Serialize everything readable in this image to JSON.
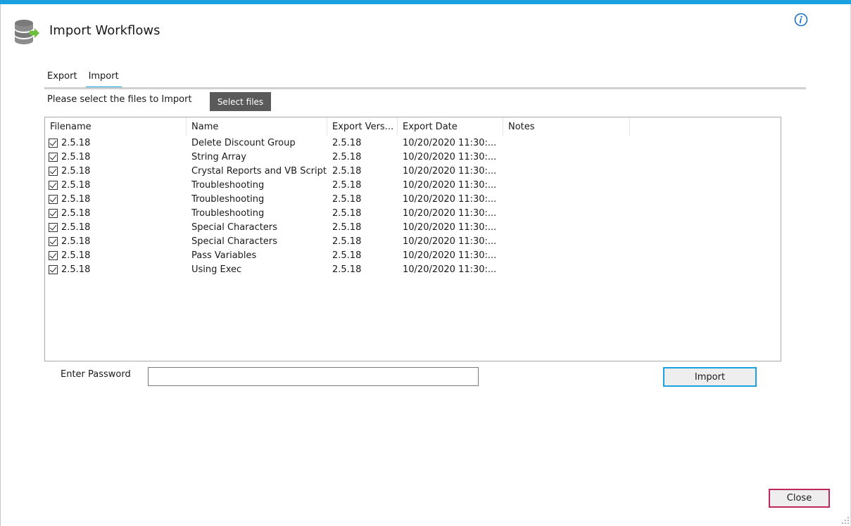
{
  "window": {
    "title": "Import Workflows"
  },
  "tabs": [
    {
      "label": "Export",
      "active": false
    },
    {
      "label": "Import",
      "active": true
    }
  ],
  "import": {
    "prompt": "Please select the files to Import",
    "select_button": "Select files"
  },
  "grid": {
    "columns": [
      "Filename",
      "Name",
      "Export Vers...",
      "Export Date",
      "Notes"
    ],
    "rows": [
      {
        "checked": true,
        "filename": "2.5.18",
        "name": "Delete Discount Group",
        "version": "2.5.18",
        "date": "10/20/2020 11:30:...",
        "notes": ""
      },
      {
        "checked": true,
        "filename": "2.5.18",
        "name": "String Array",
        "version": "2.5.18",
        "date": "10/20/2020 11:30:...",
        "notes": ""
      },
      {
        "checked": true,
        "filename": "2.5.18",
        "name": "Crystal Reports and VB Script",
        "version": "2.5.18",
        "date": "10/20/2020 11:30:...",
        "notes": ""
      },
      {
        "checked": true,
        "filename": "2.5.18",
        "name": "Troubleshooting",
        "version": "2.5.18",
        "date": "10/20/2020 11:30:...",
        "notes": ""
      },
      {
        "checked": true,
        "filename": "2.5.18",
        "name": "Troubleshooting",
        "version": "2.5.18",
        "date": "10/20/2020 11:30:...",
        "notes": ""
      },
      {
        "checked": true,
        "filename": "2.5.18",
        "name": "Troubleshooting",
        "version": "2.5.18",
        "date": "10/20/2020 11:30:...",
        "notes": ""
      },
      {
        "checked": true,
        "filename": "2.5.18",
        "name": "Special Characters",
        "version": "2.5.18",
        "date": "10/20/2020 11:30:...",
        "notes": ""
      },
      {
        "checked": true,
        "filename": "2.5.18",
        "name": "Special Characters",
        "version": "2.5.18",
        "date": "10/20/2020 11:30:...",
        "notes": ""
      },
      {
        "checked": true,
        "filename": "2.5.18",
        "name": "Pass Variables",
        "version": "2.5.18",
        "date": "10/20/2020 11:30:...",
        "notes": ""
      },
      {
        "checked": true,
        "filename": "2.5.18",
        "name": "Using Exec",
        "version": "2.5.18",
        "date": "10/20/2020 11:30:...",
        "notes": ""
      }
    ]
  },
  "password": {
    "label": "Enter Password",
    "value": "",
    "placeholder": ""
  },
  "buttons": {
    "import": "Import",
    "close": "Close"
  },
  "colors": {
    "accent": "#1ba1e2",
    "close_border": "#c0285a",
    "select_button_bg": "#5a5a5a",
    "app_icon_arrow": "#6cbf3a"
  },
  "icons": {
    "app": "database-export-icon",
    "info": "info-icon",
    "checkbox": "checkbox-checked-icon",
    "grip": "resize-grip-icon"
  }
}
